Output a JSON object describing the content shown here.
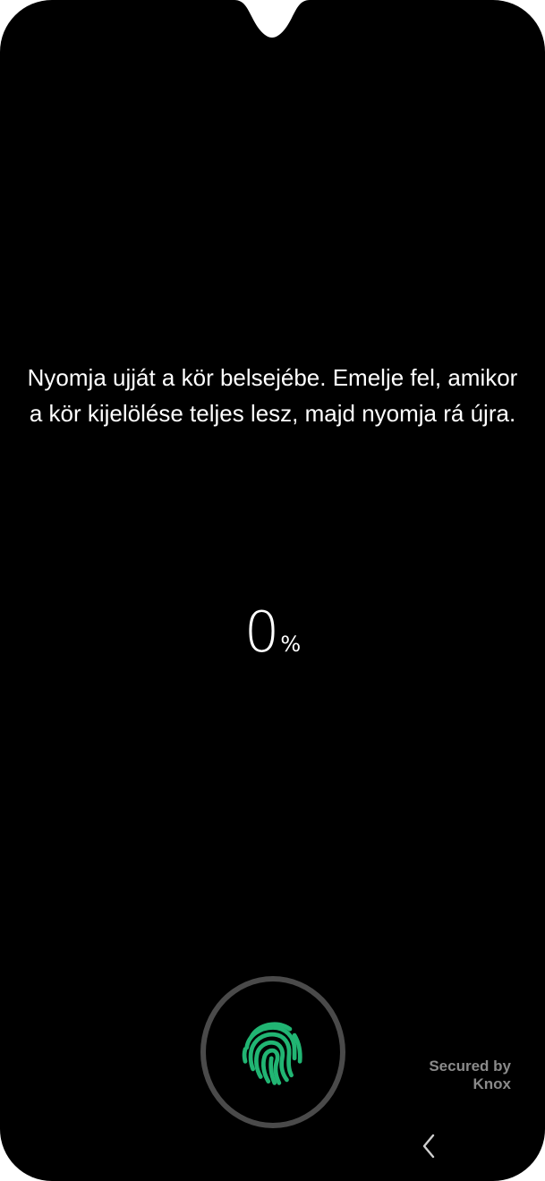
{
  "screen": {
    "instruction": "Nyomja ujját a kör belsejébe. Emelje fel, amikor a kör kijelölése teljes lesz, majd nyomja rá újra.",
    "progress": {
      "value": "0",
      "unit": "%"
    },
    "fingerprint_sensor": {
      "icon": "fingerprint-icon",
      "accent_color": "#21b573"
    },
    "secured_by": {
      "line1": "Secured by",
      "line2": "Knox"
    },
    "navigation": {
      "back_icon": "chevron-left-icon"
    }
  },
  "colors": {
    "background": "#000000",
    "text": "#ffffff",
    "ring": "#4a4a4a",
    "secondary_text": "#8a8a8a"
  }
}
